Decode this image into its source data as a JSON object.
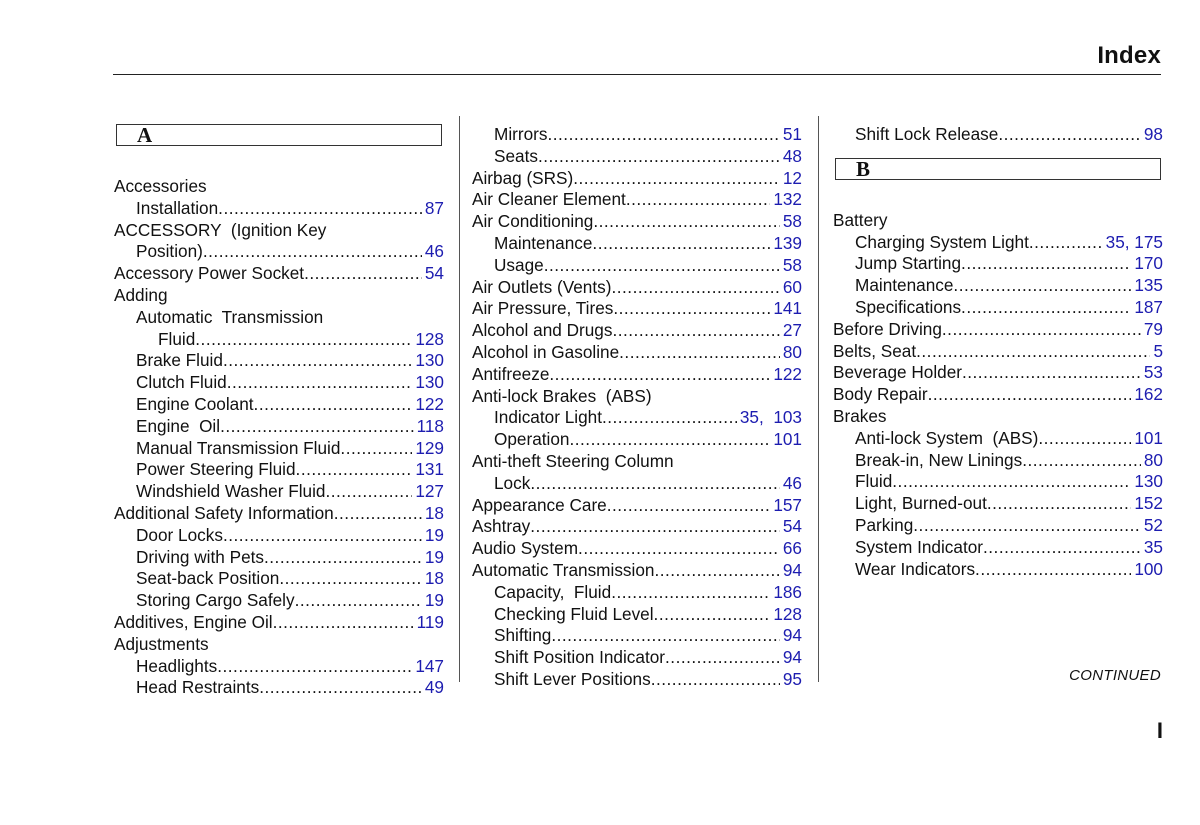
{
  "header": {
    "title": "Index"
  },
  "footer": {
    "continued": "CONTINUED",
    "page_number": "I"
  },
  "columns": [
    {
      "items": [
        {
          "type": "section",
          "letter": "A"
        },
        {
          "type": "entry",
          "level": 0,
          "label": "Accessories",
          "page": ""
        },
        {
          "type": "entry",
          "level": 1,
          "label": "Installation",
          "page": "87"
        },
        {
          "type": "entry",
          "level": 0,
          "label": "ACCESSORY  (Ignition Key",
          "page": ""
        },
        {
          "type": "entry",
          "level": 1,
          "label": "Position)",
          "page": "46"
        },
        {
          "type": "entry",
          "level": 0,
          "label": "Accessory Power Socket",
          "page": "54"
        },
        {
          "type": "entry",
          "level": 0,
          "label": "Adding",
          "page": ""
        },
        {
          "type": "entry",
          "level": 1,
          "label": "Automatic  Transmission",
          "page": ""
        },
        {
          "type": "entry",
          "level": 2,
          "label": "Fluid",
          "page": "128"
        },
        {
          "type": "entry",
          "level": 1,
          "label": "Brake Fluid",
          "page": "130"
        },
        {
          "type": "entry",
          "level": 1,
          "label": "Clutch Fluid",
          "page": "130"
        },
        {
          "type": "entry",
          "level": 1,
          "label": "Engine Coolant",
          "page": "122"
        },
        {
          "type": "entry",
          "level": 1,
          "label": "Engine  Oil",
          "page": "118"
        },
        {
          "type": "entry",
          "level": 1,
          "label": "Manual Transmission Fluid",
          "page": "129"
        },
        {
          "type": "entry",
          "level": 1,
          "label": "Power Steering Fluid",
          "page": "131"
        },
        {
          "type": "entry",
          "level": 1,
          "label": "Windshield Washer Fluid",
          "page": "127"
        },
        {
          "type": "entry",
          "level": 0,
          "label": "Additional Safety Information",
          "page": "18"
        },
        {
          "type": "entry",
          "level": 1,
          "label": "Door Locks",
          "page": "19"
        },
        {
          "type": "entry",
          "level": 1,
          "label": "Driving with Pets",
          "page": "19"
        },
        {
          "type": "entry",
          "level": 1,
          "label": "Seat-back Position",
          "page": "18"
        },
        {
          "type": "entry",
          "level": 1,
          "label": "Storing Cargo Safely",
          "page": "19"
        },
        {
          "type": "entry",
          "level": 0,
          "label": "Additives, Engine Oil",
          "page": "119"
        },
        {
          "type": "entry",
          "level": 0,
          "label": "Adjustments",
          "page": ""
        },
        {
          "type": "entry",
          "level": 1,
          "label": "Headlights",
          "page": "147"
        },
        {
          "type": "entry",
          "level": 1,
          "label": "Head Restraints",
          "page": "49"
        }
      ]
    },
    {
      "items": [
        {
          "type": "entry",
          "level": 1,
          "label": "Mirrors",
          "page": "51"
        },
        {
          "type": "entry",
          "level": 1,
          "label": "Seats",
          "page": "48"
        },
        {
          "type": "entry",
          "level": 0,
          "label": "Airbag (SRS)",
          "page": "12"
        },
        {
          "type": "entry",
          "level": 0,
          "label": "Air Cleaner Element",
          "page": "132"
        },
        {
          "type": "entry",
          "level": 0,
          "label": "Air Conditioning",
          "page": "58"
        },
        {
          "type": "entry",
          "level": 1,
          "label": "Maintenance",
          "page": "139"
        },
        {
          "type": "entry",
          "level": 1,
          "label": "Usage",
          "page": "58"
        },
        {
          "type": "entry",
          "level": 0,
          "label": "Air Outlets (Vents)",
          "page": "60"
        },
        {
          "type": "entry",
          "level": 0,
          "label": "Air Pressure, Tires",
          "page": "141"
        },
        {
          "type": "entry",
          "level": 0,
          "label": "Alcohol and Drugs",
          "page": "27"
        },
        {
          "type": "entry",
          "level": 0,
          "label": "Alcohol in Gasoline",
          "page": "80"
        },
        {
          "type": "entry",
          "level": 0,
          "label": "Antifreeze",
          "page": "122"
        },
        {
          "type": "entry",
          "level": 0,
          "label": "Anti-lock Brakes  (ABS)",
          "page": ""
        },
        {
          "type": "entry",
          "level": 1,
          "label": "Indicator Light",
          "page": "35,  103"
        },
        {
          "type": "entry",
          "level": 1,
          "label": "Operation",
          "page": "101"
        },
        {
          "type": "entry",
          "level": 0,
          "label": "Anti-theft Steering Column",
          "page": ""
        },
        {
          "type": "entry",
          "level": 1,
          "label": "Lock",
          "page": "46"
        },
        {
          "type": "entry",
          "level": 0,
          "label": "Appearance Care",
          "page": "157"
        },
        {
          "type": "entry",
          "level": 0,
          "label": "Ashtray",
          "page": "54"
        },
        {
          "type": "entry",
          "level": 0,
          "label": "Audio System",
          "page": "66"
        },
        {
          "type": "entry",
          "level": 0,
          "label": "Automatic Transmission",
          "page": "94"
        },
        {
          "type": "entry",
          "level": 1,
          "label": "Capacity,  Fluid",
          "page": "186"
        },
        {
          "type": "entry",
          "level": 1,
          "label": "Checking Fluid Level",
          "page": "128"
        },
        {
          "type": "entry",
          "level": 1,
          "label": "Shifting",
          "page": "94"
        },
        {
          "type": "entry",
          "level": 1,
          "label": "Shift Position Indicator",
          "page": "94"
        },
        {
          "type": "entry",
          "level": 1,
          "label": "Shift Lever Positions",
          "page": "95"
        }
      ]
    },
    {
      "items": [
        {
          "type": "entry",
          "level": 1,
          "label": "Shift Lock Release",
          "page": "98"
        },
        {
          "type": "spacer"
        },
        {
          "type": "section",
          "letter": "B"
        },
        {
          "type": "entry",
          "level": 0,
          "label": "Battery",
          "page": ""
        },
        {
          "type": "entry",
          "level": 1,
          "label": "Charging System Light",
          "page": "35, 175"
        },
        {
          "type": "entry",
          "level": 1,
          "label": "Jump Starting",
          "page": "170"
        },
        {
          "type": "entry",
          "level": 1,
          "label": "Maintenance",
          "page": "135"
        },
        {
          "type": "entry",
          "level": 1,
          "label": "Specifications",
          "page": "187"
        },
        {
          "type": "entry",
          "level": 0,
          "label": "Before Driving",
          "page": "79"
        },
        {
          "type": "entry",
          "level": 0,
          "label": "Belts, Seat",
          "page": "5"
        },
        {
          "type": "entry",
          "level": 0,
          "label": "Beverage Holder",
          "page": "53"
        },
        {
          "type": "entry",
          "level": 0,
          "label": "Body Repair",
          "page": "162"
        },
        {
          "type": "entry",
          "level": 0,
          "label": "Brakes",
          "page": ""
        },
        {
          "type": "entry",
          "level": 1,
          "label": "Anti-lock System  (ABS)",
          "page": "101"
        },
        {
          "type": "entry",
          "level": 1,
          "label": "Break-in, New Linings",
          "page": "80"
        },
        {
          "type": "entry",
          "level": 1,
          "label": "Fluid",
          "page": "130"
        },
        {
          "type": "entry",
          "level": 1,
          "label": "Light, Burned-out",
          "page": "152"
        },
        {
          "type": "entry",
          "level": 1,
          "label": "Parking",
          "page": "52"
        },
        {
          "type": "entry",
          "level": 1,
          "label": "System Indicator",
          "page": "35"
        },
        {
          "type": "entry",
          "level": 1,
          "label": "Wear Indicators",
          "page": "100"
        }
      ]
    }
  ],
  "colors": {
    "text": "#111111",
    "page_link": "#1d1db0",
    "rule": "#222222"
  }
}
